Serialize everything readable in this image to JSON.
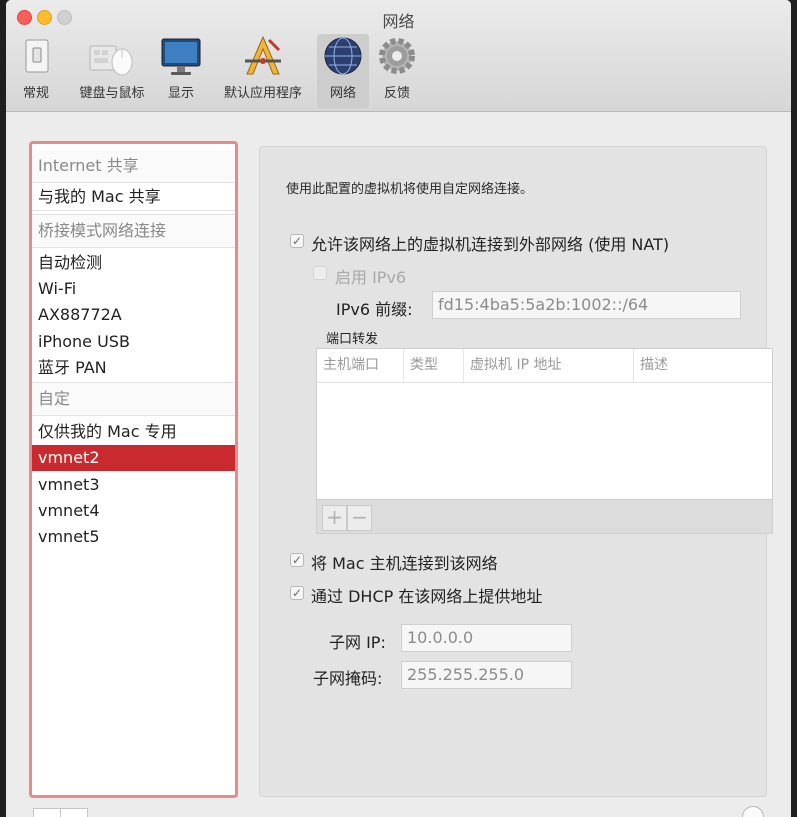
{
  "window": {
    "title": "网络"
  },
  "toolbar": {
    "items": [
      {
        "label": "常规"
      },
      {
        "label": "键盘与鼠标"
      },
      {
        "label": "显示"
      },
      {
        "label": "默认应用程序"
      },
      {
        "label": "网络"
      },
      {
        "label": "反馈"
      }
    ]
  },
  "sidebar": {
    "items": [
      {
        "label": "Internet 共享",
        "kind": "header"
      },
      {
        "label": "与我的 Mac 共享",
        "kind": "item"
      },
      {
        "label": "桥接模式网络连接",
        "kind": "header"
      },
      {
        "label": "自动检测",
        "kind": "item"
      },
      {
        "label": "Wi-Fi",
        "kind": "item"
      },
      {
        "label": "AX88772A",
        "kind": "item"
      },
      {
        "label": "iPhone USB",
        "kind": "item"
      },
      {
        "label": "蓝牙 PAN",
        "kind": "item"
      },
      {
        "label": "自定",
        "kind": "header"
      },
      {
        "label": "仅供我的 Mac 专用",
        "kind": "item"
      },
      {
        "label": "vmnet2",
        "kind": "item",
        "selected": true
      },
      {
        "label": "vmnet3",
        "kind": "item"
      },
      {
        "label": "vmnet4",
        "kind": "item"
      },
      {
        "label": "vmnet5",
        "kind": "item"
      }
    ]
  },
  "panel": {
    "description": "使用此配置的虚拟机将使用自定网络连接。",
    "nat": {
      "label": "允许该网络上的虚拟机连接到外部网络 (使用 NAT)",
      "checked": true
    },
    "ipv6": {
      "label": "启用 IPv6",
      "checked": false
    },
    "ipv6_prefix": {
      "label": "IPv6 前缀:",
      "value": "fd15:4ba5:5a2b:1002::/64"
    },
    "port_forwarding": {
      "label": "端口转发",
      "columns": [
        "主机端口",
        "类型",
        "虚拟机 IP 地址",
        "描述"
      ],
      "add": "+",
      "remove": "−"
    },
    "connect_host": {
      "label": "将 Mac 主机连接到该网络",
      "checked": true
    },
    "dhcp": {
      "label": "通过 DHCP 在该网络上提供地址",
      "checked": true
    },
    "subnet_ip": {
      "label": "子网 IP:",
      "value": "10.0.0.0"
    },
    "subnet_mask": {
      "label": "子网掩码:",
      "value": "255.255.255.0"
    }
  },
  "colors": {
    "selection": "#c82a2f",
    "sidebar_border": "#e48b8b"
  }
}
